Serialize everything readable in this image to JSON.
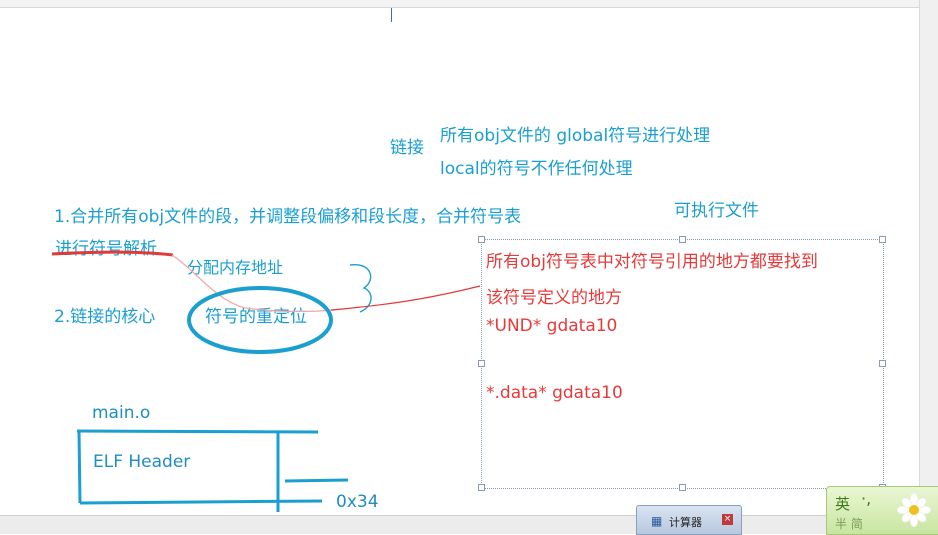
{
  "notes": {
    "link_label": "链接",
    "global_line": "所有obj文件的 global符号进行处理",
    "local_line": "local的符号不作任何处理",
    "step1": "1.合并所有obj文件的段，并调整段偏移和段长度，合并符号表",
    "step1_cont": "进行符号解析",
    "alloc": "分配内存地址",
    "step2": "2.链接的核心",
    "reloc": "符号的重定位",
    "executable": "可执行文件",
    "main_o": "main.o",
    "elf_header": "ELF Header",
    "offset": "0x34"
  },
  "red_notes": {
    "line1": "所有obj符号表中对符号引用的地方都要找到",
    "line2": "该符号定义的地方",
    "und": "*UND*   gdata10",
    "data": "*.data*  gdata10"
  },
  "taskbar": {
    "calculator": "计算器",
    "ime_mode": "英",
    "ime_dot": "·,",
    "ime_sub": "半 简"
  }
}
